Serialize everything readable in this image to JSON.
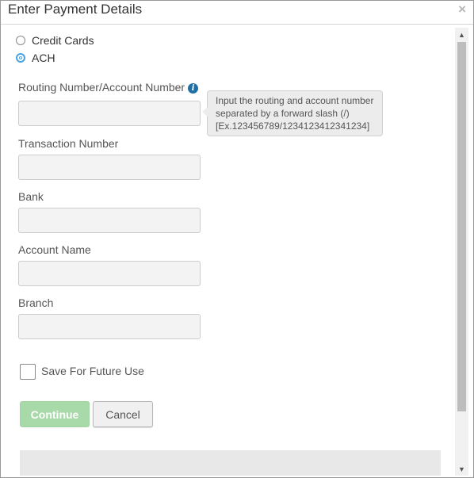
{
  "dialog": {
    "title": "Enter Payment Details",
    "close_label": "×"
  },
  "payment_type": {
    "options": [
      {
        "label": "Credit Cards",
        "selected": false
      },
      {
        "label": "ACH",
        "selected": true
      }
    ]
  },
  "fields": {
    "routing": {
      "label": "Routing Number/Account Number",
      "value": "",
      "placeholder": ""
    },
    "transaction": {
      "label": "Transaction Number",
      "value": "",
      "placeholder": ""
    },
    "bank": {
      "label": "Bank",
      "value": "",
      "placeholder": ""
    },
    "account_name": {
      "label": "Account Name",
      "value": "",
      "placeholder": ""
    },
    "branch": {
      "label": "Branch",
      "value": "",
      "placeholder": ""
    }
  },
  "tooltip": {
    "line1": "Input the routing and account number",
    "line2": "separated by a forward slash (/)",
    "line3": "[Ex.123456789/1234123412341234]"
  },
  "save_for_future": {
    "label": "Save For Future Use",
    "checked": false
  },
  "buttons": {
    "continue": "Continue",
    "cancel": "Cancel"
  },
  "icons": {
    "info": "info-circle-icon",
    "close": "close-icon",
    "scroll_up": "chevron-up-icon",
    "scroll_down": "chevron-down-icon"
  },
  "colors": {
    "radio_accent": "#4aa3df",
    "info_icon": "#1d6fa5",
    "continue_disabled": "#a8d9a8"
  }
}
